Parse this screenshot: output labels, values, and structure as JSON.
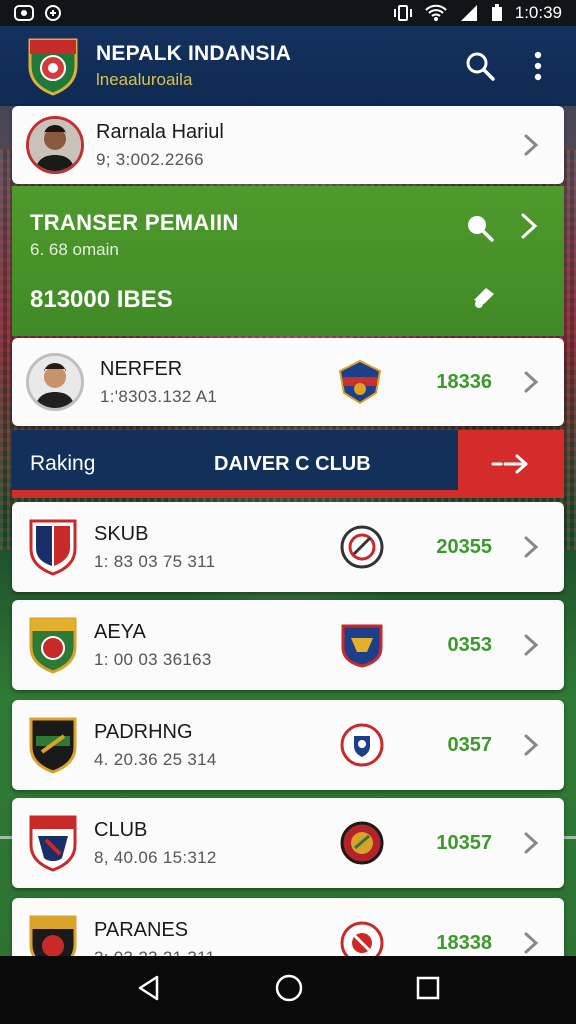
{
  "status_bar": {
    "time": "1:0:39"
  },
  "app": {
    "title": "NEPALK INDANSIA",
    "subtitle": "lneaaluroaila"
  },
  "profile_card": {
    "name": "Rarnala Hariul",
    "detail": "9; 3:002.2266"
  },
  "transfer": {
    "title": "TRANSER PEMAIIN",
    "subtitle": "6. 68 omain",
    "amount": "813000 IBES"
  },
  "player_card": {
    "name": "NERFER",
    "detail": "1:'8303.132 A1",
    "value": "18336"
  },
  "ranking": {
    "label": "Raking",
    "club_header": "DAIVER C CLUB"
  },
  "clubs": [
    {
      "name": "SKUB",
      "detail": "1: 83 03 75 311",
      "value": "20355"
    },
    {
      "name": "AEYA",
      "detail": "1: 00 03 36163",
      "value": "0353"
    },
    {
      "name": "PADRHNG",
      "detail": "4. 20.36 25 314",
      "value": "0357"
    },
    {
      "name": "CLUB",
      "detail": "8, 40.06 15:312",
      "value": "10357"
    },
    {
      "name": "PARANES",
      "detail": "2: 03 23 21 311",
      "value": "18338"
    }
  ],
  "colors": {
    "header_blue": "#14325e",
    "accent_green": "#4f9a2c",
    "accent_red": "#d42b2b",
    "value_green": "#3a9a2a"
  }
}
